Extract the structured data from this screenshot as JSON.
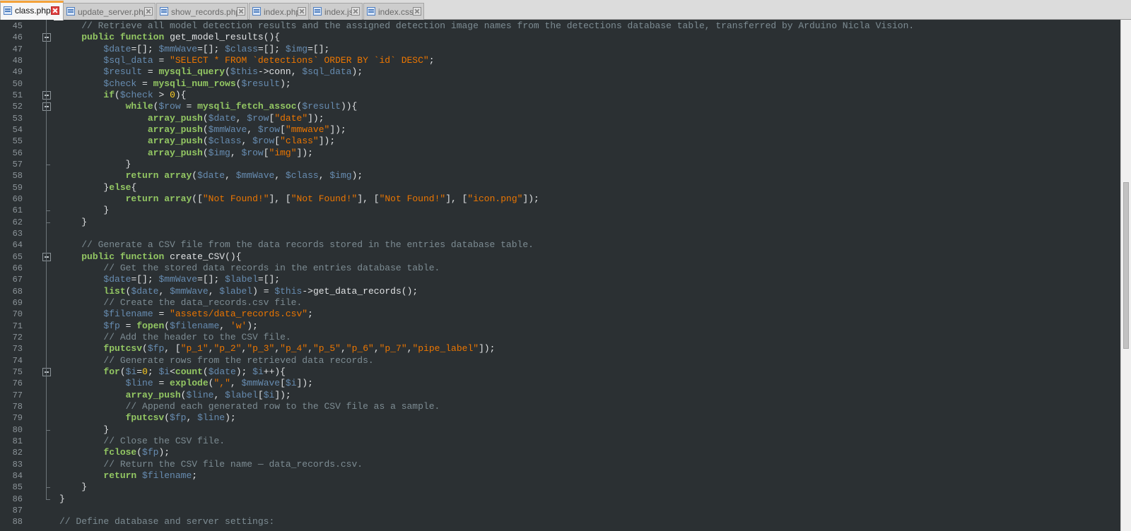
{
  "tabs": [
    {
      "label": "class.php",
      "active": true
    },
    {
      "label": "update_server.php",
      "active": false
    },
    {
      "label": "show_records.php",
      "active": false
    },
    {
      "label": "index.php",
      "active": false
    },
    {
      "label": "index.js",
      "active": false
    },
    {
      "label": "index.css",
      "active": false
    }
  ],
  "colors": {
    "editor_background": "#2b3033",
    "comment": "#7d8c93",
    "keyword": "#93c763",
    "variable": "#678cb1",
    "string": "#ec7600",
    "number": "#ffcd22",
    "active_tab_accent": "#f4a23a"
  },
  "editor": {
    "lines": [
      {
        "num": "45",
        "code": "    // Retrieve all model detection results and the assigned detection image names from the detections database table, transferred by Arduino Nicla Vision."
      },
      {
        "num": "46",
        "code": "    public function get_model_results(){"
      },
      {
        "num": "47",
        "code": "        $date=[]; $mmWave=[]; $class=[]; $img=[];"
      },
      {
        "num": "48",
        "code": "        $sql_data = \"SELECT * FROM `detections` ORDER BY `id` DESC\";"
      },
      {
        "num": "49",
        "code": "        $result = mysqli_query($this->conn, $sql_data);"
      },
      {
        "num": "50",
        "code": "        $check = mysqli_num_rows($result);"
      },
      {
        "num": "51",
        "code": "        if($check > 0){"
      },
      {
        "num": "52",
        "code": "            while($row = mysqli_fetch_assoc($result)){"
      },
      {
        "num": "53",
        "code": "                array_push($date, $row[\"date\"]);"
      },
      {
        "num": "54",
        "code": "                array_push($mmWave, $row[\"mmwave\"]);"
      },
      {
        "num": "55",
        "code": "                array_push($class, $row[\"class\"]);"
      },
      {
        "num": "56",
        "code": "                array_push($img, $row[\"img\"]);"
      },
      {
        "num": "57",
        "code": "            }"
      },
      {
        "num": "58",
        "code": "            return array($date, $mmWave, $class, $img);"
      },
      {
        "num": "59",
        "code": "        }else{"
      },
      {
        "num": "60",
        "code": "            return array([\"Not Found!\"], [\"Not Found!\"], [\"Not Found!\"], [\"icon.png\"]);"
      },
      {
        "num": "61",
        "code": "        }"
      },
      {
        "num": "62",
        "code": "    }"
      },
      {
        "num": "63",
        "code": ""
      },
      {
        "num": "64",
        "code": "    // Generate a CSV file from the data records stored in the entries database table."
      },
      {
        "num": "65",
        "code": "    public function create_CSV(){"
      },
      {
        "num": "66",
        "code": "        // Get the stored data records in the entries database table."
      },
      {
        "num": "67",
        "code": "        $date=[]; $mmWave=[]; $label=[];"
      },
      {
        "num": "68",
        "code": "        list($date, $mmWave, $label) = $this->get_data_records();"
      },
      {
        "num": "69",
        "code": "        // Create the data_records.csv file."
      },
      {
        "num": "70",
        "code": "        $filename = \"assets/data_records.csv\";"
      },
      {
        "num": "71",
        "code": "        $fp = fopen($filename, 'w');"
      },
      {
        "num": "72",
        "code": "        // Add the header to the CSV file."
      },
      {
        "num": "73",
        "code": "        fputcsv($fp, [\"p_1\",\"p_2\",\"p_3\",\"p_4\",\"p_5\",\"p_6\",\"p_7\",\"pipe_label\"]);"
      },
      {
        "num": "74",
        "code": "        // Generate rows from the retrieved data records."
      },
      {
        "num": "75",
        "code": "        for($i=0; $i<count($date); $i++){"
      },
      {
        "num": "76",
        "code": "            $line = explode(\",\", $mmWave[$i]);"
      },
      {
        "num": "77",
        "code": "            array_push($line, $label[$i]);"
      },
      {
        "num": "78",
        "code": "            // Append each generated row to the CSV file as a sample."
      },
      {
        "num": "79",
        "code": "            fputcsv($fp, $line);"
      },
      {
        "num": "80",
        "code": "        }"
      },
      {
        "num": "81",
        "code": "        // Close the CSV file."
      },
      {
        "num": "82",
        "code": "        fclose($fp);"
      },
      {
        "num": "83",
        "code": "        // Return the CSV file name — data_records.csv."
      },
      {
        "num": "84",
        "code": "        return $filename;"
      },
      {
        "num": "85",
        "code": "    }"
      },
      {
        "num": "86",
        "code": "}"
      },
      {
        "num": "87",
        "code": ""
      },
      {
        "num": "88",
        "code": "// Define database and server settings:"
      }
    ]
  }
}
